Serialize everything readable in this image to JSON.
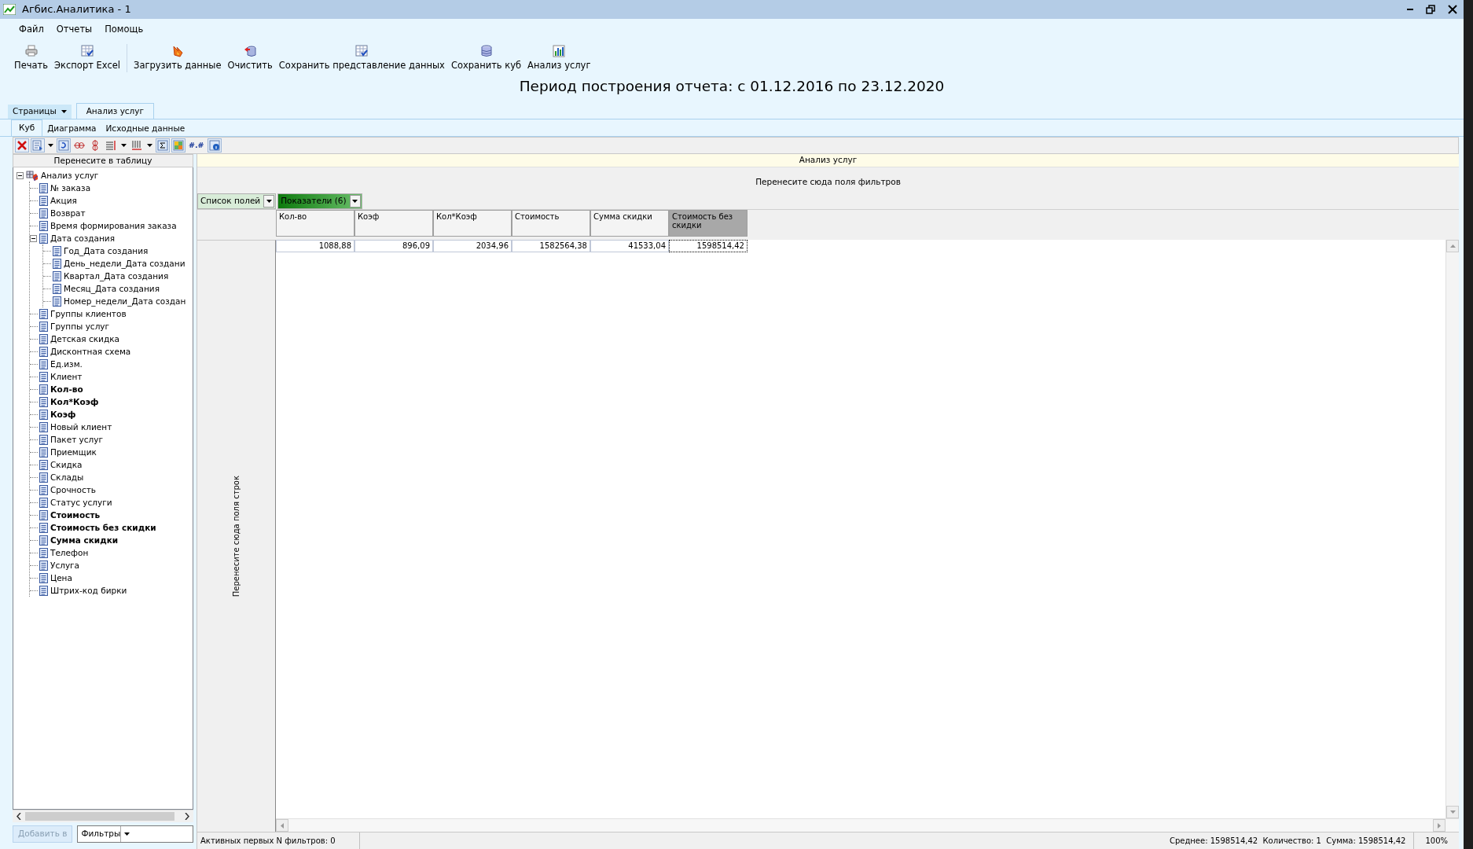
{
  "window": {
    "title": "Агбис.Аналитика - 1"
  },
  "menu": [
    "Файл",
    "Отчеты",
    "Помощь"
  ],
  "toolbar": [
    {
      "kind": "print",
      "label": "Печать"
    },
    {
      "kind": "excel",
      "label": "Экспорт Excel"
    },
    {
      "kind": "load",
      "label": "Загрузить данные"
    },
    {
      "kind": "clear",
      "label": "Очистить"
    },
    {
      "kind": "save_view",
      "label": "Сохранить представление данных"
    },
    {
      "kind": "save_cube",
      "label": "Сохранить куб"
    },
    {
      "kind": "chart",
      "label": "Анализ услуг"
    }
  ],
  "period_title": "Период построения отчета: с 01.12.2016 по 23.12.2020",
  "pages_menu": "Страницы",
  "page_tabs": [
    {
      "label": "Анализ услуг",
      "selected": true
    }
  ],
  "sub_tabs": [
    {
      "label": "Куб",
      "selected": true
    },
    {
      "label": "Диаграмма",
      "selected": false
    },
    {
      "label": "Исходные данные",
      "selected": false
    }
  ],
  "cube_toolbar": {
    "number_format_label": "#.#"
  },
  "field_panel": {
    "header": "Перенесите в таблицу",
    "tree": {
      "label": "Анализ услуг",
      "expanded": true,
      "children": [
        {
          "label": "№ заказа",
          "kind": "dimension"
        },
        {
          "label": "Акция",
          "kind": "dimension"
        },
        {
          "label": "Возврат",
          "kind": "dimension"
        },
        {
          "label": "Время формирования заказа",
          "kind": "dimension"
        },
        {
          "label": "Дата создания",
          "kind": "dimension",
          "expanded": true,
          "children": [
            {
              "label": "Год_Дата создания",
              "kind": "dimension"
            },
            {
              "label": "День_недели_Дата создани",
              "kind": "dimension"
            },
            {
              "label": "Квартал_Дата создания",
              "kind": "dimension"
            },
            {
              "label": "Месяц_Дата создания",
              "kind": "dimension"
            },
            {
              "label": "Номер_недели_Дата создан",
              "kind": "dimension"
            }
          ]
        },
        {
          "label": "Группы клиентов",
          "kind": "dimension"
        },
        {
          "label": "Группы услуг",
          "kind": "dimension"
        },
        {
          "label": "Детская скидка",
          "kind": "dimension"
        },
        {
          "label": "Дисконтная схема",
          "kind": "dimension"
        },
        {
          "label": "Ед.изм.",
          "kind": "dimension"
        },
        {
          "label": "Клиент",
          "kind": "dimension"
        },
        {
          "label": "Кол-во",
          "kind": "measure"
        },
        {
          "label": "Кол*Коэф",
          "kind": "measure"
        },
        {
          "label": "Коэф",
          "kind": "measure"
        },
        {
          "label": "Новый клиент",
          "kind": "dimension"
        },
        {
          "label": "Пакет услуг",
          "kind": "dimension"
        },
        {
          "label": "Приемщик",
          "kind": "dimension"
        },
        {
          "label": "Скидка",
          "kind": "dimension"
        },
        {
          "label": "Склады",
          "kind": "dimension"
        },
        {
          "label": "Срочность",
          "kind": "dimension"
        },
        {
          "label": "Статус услуги",
          "kind": "dimension"
        },
        {
          "label": "Стоимость",
          "kind": "measure"
        },
        {
          "label": "Стоимость без скидки",
          "kind": "measure"
        },
        {
          "label": "Сумма скидки",
          "kind": "measure"
        },
        {
          "label": "Телефон",
          "kind": "dimension"
        },
        {
          "label": "Услуга",
          "kind": "dimension"
        },
        {
          "label": "Цена",
          "kind": "dimension"
        },
        {
          "label": "Штрих-код бирки",
          "kind": "dimension"
        }
      ]
    },
    "add_button": {
      "label": "Добавить в",
      "disabled": true
    },
    "target_select": {
      "value": "Фильтры"
    }
  },
  "pivot": {
    "title": "Анализ услуг",
    "filter_zone": "Перенесите сюда поля фильтров",
    "field_buttons": [
      {
        "label": "Список полей",
        "selected": false
      },
      {
        "label": "Показатели (6)",
        "selected": true
      }
    ],
    "columns": [
      {
        "label": "Кол-во",
        "selected": false
      },
      {
        "label": "Коэф",
        "selected": false
      },
      {
        "label": "Кол*Коэф",
        "selected": false
      },
      {
        "label": "Стоимость",
        "selected": false
      },
      {
        "label": "Сумма скидки",
        "selected": false
      },
      {
        "label": "Стоимость без скидки",
        "selected": true
      }
    ],
    "values": [
      "1088,88",
      "896,09",
      "2034,96",
      "1582564,38",
      "41533,04",
      "1598514,42"
    ],
    "row_zone": "Перенесите сюда поля строк"
  },
  "status_bar": {
    "filters": "Активных первых N фильтров: 0",
    "summary": "Среднее: 1598514,42  Количество: 1  Сумма: 1598514,42",
    "zoom": "100%"
  }
}
